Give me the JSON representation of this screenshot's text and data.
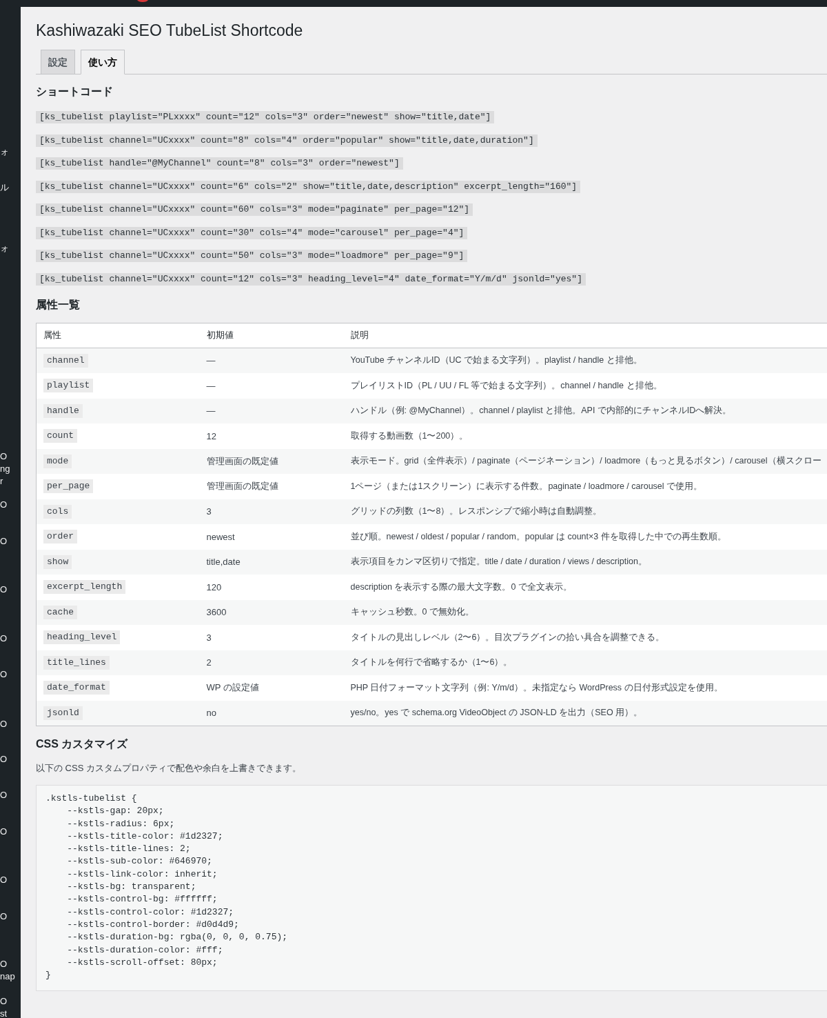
{
  "admin_sidebar": {
    "items": [
      {
        "lines": [
          "ォ"
        ]
      },
      {
        "lines": [
          "ル"
        ]
      },
      {
        "lines": [
          "ォ"
        ]
      },
      {
        "lines": [
          "O",
          "ng",
          "r"
        ]
      },
      {
        "lines": [
          "O"
        ]
      },
      {
        "lines": [
          "O"
        ]
      },
      {
        "lines": [
          "O"
        ]
      },
      {
        "lines": [
          "O"
        ]
      },
      {
        "lines": [
          "O"
        ]
      },
      {
        "lines": [
          "O"
        ]
      },
      {
        "lines": [
          "O"
        ]
      },
      {
        "lines": [
          "O"
        ]
      },
      {
        "lines": [
          "O"
        ]
      },
      {
        "lines": [
          "O"
        ]
      },
      {
        "lines": [
          "O"
        ]
      },
      {
        "lines": [
          "O",
          "nap"
        ]
      },
      {
        "lines": [
          "O",
          "st"
        ]
      }
    ]
  },
  "page": {
    "title": "Kashiwazaki SEO TubeList Shortcode"
  },
  "tabs": [
    {
      "label": "設定",
      "selected": false
    },
    {
      "label": "使い方",
      "selected": true
    }
  ],
  "shortcodes": {
    "heading": "ショートコード",
    "examples": [
      "[ks_tubelist playlist=\"PLxxxx\" count=\"12\" cols=\"3\" order=\"newest\" show=\"title,date\"]",
      "[ks_tubelist channel=\"UCxxxx\" count=\"8\" cols=\"4\" order=\"popular\" show=\"title,date,duration\"]",
      "[ks_tubelist handle=\"@MyChannel\" count=\"8\" cols=\"3\" order=\"newest\"]",
      "[ks_tubelist channel=\"UCxxxx\" count=\"6\" cols=\"2\" show=\"title,date,description\" excerpt_length=\"160\"]",
      "[ks_tubelist channel=\"UCxxxx\" count=\"60\" cols=\"3\" mode=\"paginate\" per_page=\"12\"]",
      "[ks_tubelist channel=\"UCxxxx\" count=\"30\" cols=\"4\" mode=\"carousel\" per_page=\"4\"]",
      "[ks_tubelist channel=\"UCxxxx\" count=\"50\" cols=\"3\" mode=\"loadmore\" per_page=\"9\"]",
      "[ks_tubelist channel=\"UCxxxx\" count=\"12\" cols=\"3\" heading_level=\"4\" date_format=\"Y/m/d\" jsonld=\"yes\"]"
    ]
  },
  "attributes": {
    "heading": "属性一覧",
    "columns": [
      "属性",
      "初期値",
      "説明"
    ],
    "rows": [
      {
        "name": "channel",
        "default": "—",
        "description": "YouTube チャンネルID（UC で始まる文字列）。playlist / handle と排他。"
      },
      {
        "name": "playlist",
        "default": "—",
        "description": "プレイリストID（PL / UU / FL 等で始まる文字列）。channel / handle と排他。"
      },
      {
        "name": "handle",
        "default": "—",
        "description": "ハンドル（例: @MyChannel）。channel / playlist と排他。API で内部的にチャンネルIDへ解決。"
      },
      {
        "name": "count",
        "default": "12",
        "description": "取得する動画数（1〜200）。"
      },
      {
        "name": "mode",
        "default": "管理画面の既定値",
        "description": "表示モード。grid（全件表示）/ paginate（ページネーション）/ loadmore（もっと見るボタン）/ carousel（横スクロー"
      },
      {
        "name": "per_page",
        "default": "管理画面の既定値",
        "description": "1ページ（または1スクリーン）に表示する件数。paginate / loadmore / carousel で使用。"
      },
      {
        "name": "cols",
        "default": "3",
        "description": "グリッドの列数（1〜8）。レスポンシブで縮小時は自動調整。"
      },
      {
        "name": "order",
        "default": "newest",
        "description": "並び順。newest / oldest / popular / random。popular は count×3 件を取得した中での再生数順。"
      },
      {
        "name": "show",
        "default": "title,date",
        "description": "表示項目をカンマ区切りで指定。title / date / duration / views / description。"
      },
      {
        "name": "excerpt_length",
        "default": "120",
        "description": "description を表示する際の最大文字数。0 で全文表示。"
      },
      {
        "name": "cache",
        "default": "3600",
        "description": "キャッシュ秒数。0 で無効化。"
      },
      {
        "name": "heading_level",
        "default": "3",
        "description": "タイトルの見出しレベル（2〜6）。目次プラグインの拾い具合を調整できる。"
      },
      {
        "name": "title_lines",
        "default": "2",
        "description": "タイトルを何行で省略するか（1〜6）。"
      },
      {
        "name": "date_format",
        "default": "WP の設定値",
        "description": "PHP 日付フォーマット文字列（例: Y/m/d）。未指定なら WordPress の日付形式設定を使用。"
      },
      {
        "name": "jsonld",
        "default": "no",
        "description": "yes/no。yes で schema.org VideoObject の JSON-LD を出力（SEO 用）。"
      }
    ]
  },
  "css_customize": {
    "heading": "CSS カスタマイズ",
    "intro": "以下の CSS カスタムプロパティで配色や余白を上書きできます。",
    "code": ".kstls-tubelist {\n    --kstls-gap: 20px;\n    --kstls-radius: 6px;\n    --kstls-title-color: #1d2327;\n    --kstls-title-lines: 2;\n    --kstls-sub-color: #646970;\n    --kstls-link-color: inherit;\n    --kstls-bg: transparent;\n    --kstls-control-bg: #ffffff;\n    --kstls-control-color: #1d2327;\n    --kstls-control-border: #d0d4d9;\n    --kstls-duration-bg: rgba(0, 0, 0, 0.75);\n    --kstls-duration-color: #fff;\n    --kstls-scroll-offset: 80px;\n}"
  }
}
